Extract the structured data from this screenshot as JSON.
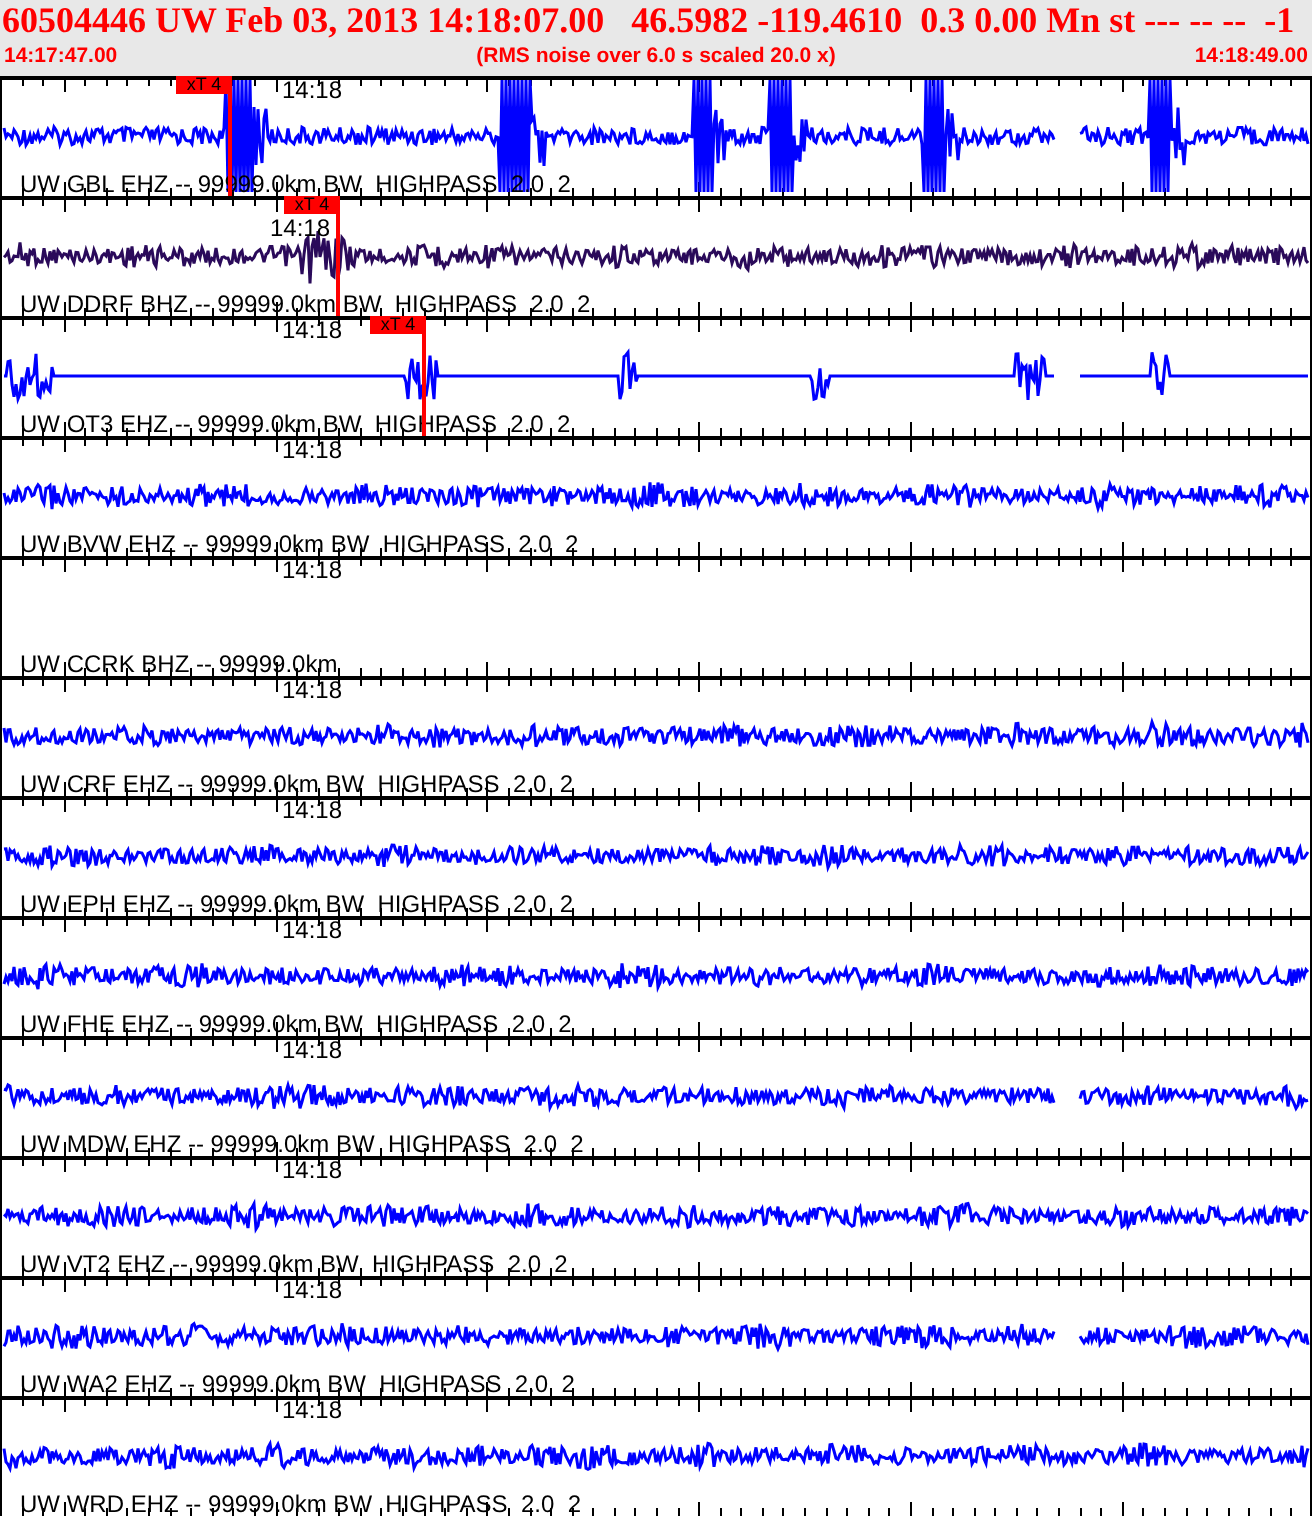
{
  "header": {
    "title": "60504446 UW Feb 03, 2013 14:18:07.00   46.5982 -119.4610  0.3 0.00 Mn st --- -- --  -1",
    "start_time": "14:17:47.00",
    "subtitle": "(RMS noise over 6.0 s scaled 20.0 x)",
    "end_time": "14:18:49.00"
  },
  "traces": [
    {
      "label": "UW GBL EHZ -- 99999.0km BW  HIGHPASS  2.0  2",
      "time_label": "14:18",
      "color": "#0000ff",
      "kind": "events",
      "gap": true,
      "pick": "xT 4"
    },
    {
      "label": "UW DDRF BHZ -- 99999.0km BW  HIGHPASS  2.0  2",
      "time_label": "14:18",
      "color": "#2a0a5a",
      "kind": "noise",
      "gap": false,
      "pick": "xT 4"
    },
    {
      "label": "UW OT3 EHZ -- 99999.0km BW  HIGHPASS  2.0  2",
      "time_label": "14:18",
      "color": "#0000ff",
      "kind": "bursts",
      "gap": true,
      "pick": "xT 4"
    },
    {
      "label": "UW BVW EHZ -- 99999.0km BW  HIGHPASS  2.0  2",
      "time_label": "14:18",
      "color": "#0000ff",
      "kind": "noise",
      "gap": false
    },
    {
      "label": "UW CCRK BHZ -- 99999.0km",
      "time_label": "14:18",
      "kind": "none"
    },
    {
      "label": "UW CRF EHZ -- 99999.0km BW  HIGHPASS  2.0  2",
      "time_label": "14:18",
      "color": "#0000ff",
      "kind": "noise",
      "gap": false
    },
    {
      "label": "UW EPH EHZ -- 99999.0km BW  HIGHPASS  2.0  2",
      "time_label": "14:18",
      "color": "#0000ff",
      "kind": "noise",
      "gap": false
    },
    {
      "label": "UW FHE EHZ -- 99999.0km BW  HIGHPASS  2.0  2",
      "time_label": "14:18",
      "color": "#0000ff",
      "kind": "noise",
      "gap": false
    },
    {
      "label": "UW MDW EHZ -- 99999.0km BW  HIGHPASS  2.0  2",
      "time_label": "14:18",
      "color": "#0000ff",
      "kind": "noise",
      "gap": true
    },
    {
      "label": "UW VT2 EHZ -- 99999.0km BW  HIGHPASS  2.0  2",
      "time_label": "14:18",
      "color": "#0000ff",
      "kind": "noise",
      "gap": false
    },
    {
      "label": "UW WA2 EHZ -- 99999.0km BW  HIGHPASS  2.0  2",
      "time_label": "14:18",
      "color": "#0000ff",
      "kind": "noise",
      "gap": true
    },
    {
      "label": "UW WRD EHZ -- 99999.0km BW  HIGHPASS  2.0  2",
      "time_label": "14:18",
      "color": "#0000ff",
      "kind": "noise",
      "gap": false
    }
  ]
}
